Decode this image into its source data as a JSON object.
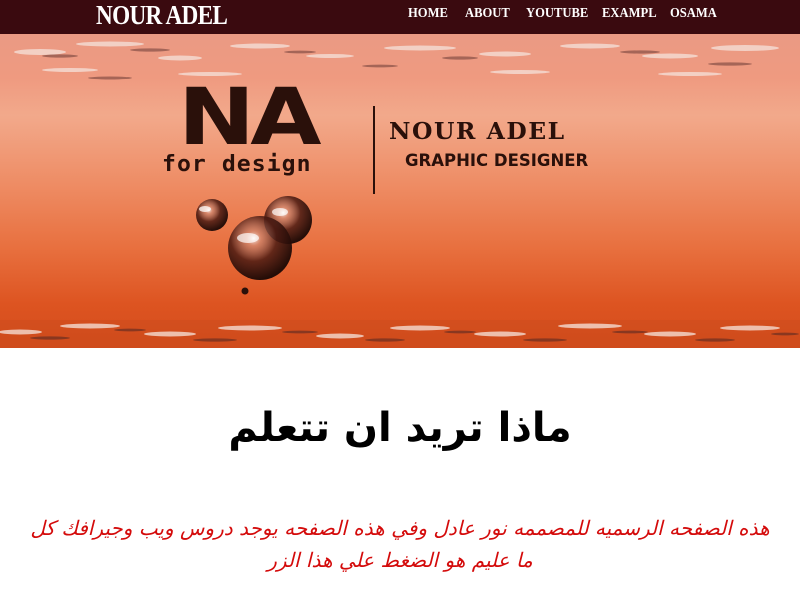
{
  "navbar": {
    "brand": "NOUR ADEL",
    "links": [
      {
        "label": "HOME"
      },
      {
        "label": "ABOUT"
      },
      {
        "label": "YOUTUBE"
      },
      {
        "label": "EXAMPL"
      },
      {
        "label": "OSAMA"
      }
    ]
  },
  "hero": {
    "logo_mark": "NA",
    "logo_tagline": "for design",
    "designer_name": "NOUR ADEL",
    "designer_role": "GRAPHIC DESIGNER"
  },
  "content": {
    "heading": "ماذا تريد ان تتعلم",
    "text": "هذه الصفحه الرسميه للمصممه نور عادل وفي هذه الصفحه يوجد دروس ويب وجيرافك كل ما عليم هو الضغط علي هذا الزر"
  },
  "colors": {
    "navbar_bg": "#3a0a0f",
    "hero_top": "#ea9a84",
    "hero_bottom": "#d34c1c",
    "logo_ink": "#2a100a",
    "text_red": "#d40b0b"
  }
}
